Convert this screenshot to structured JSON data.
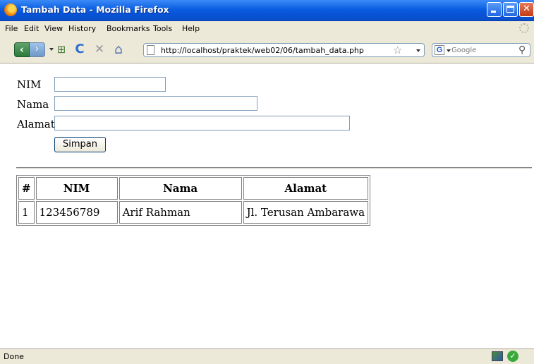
{
  "window": {
    "title": "Tambah Data - Mozilla Firefox"
  },
  "menu": [
    "File",
    "Edit",
    "View",
    "History",
    "Bookmarks",
    "Tools",
    "Help"
  ],
  "nav": {
    "url": "http://localhost/praktek/web02/06/tambah_data.php",
    "search_placeholder": "Google",
    "back_glyph": "‹",
    "forward_glyph": "›",
    "reload_glyph": "C",
    "stop_glyph": "✕",
    "home_glyph": "⌂",
    "bookmark_star_glyph": "☆",
    "search_engine_glyph": "G",
    "search_glyph": "⚲"
  },
  "form": {
    "nim_label": "NIM",
    "nama_label": "Nama",
    "alamat_label": "Alamat",
    "nim_value": "",
    "nama_value": "",
    "alamat_value": "",
    "submit_label": "Simpan"
  },
  "table": {
    "headers": [
      "#",
      "NIM",
      "Nama",
      "Alamat"
    ],
    "rows": [
      [
        "1",
        "123456789",
        "Arif Rahman",
        "Jl. Terusan Ambarawa"
      ]
    ]
  },
  "status": {
    "text": "Done",
    "check_glyph": "✓"
  },
  "colors": {
    "titlebar": "#0a5ee0",
    "chrome": "#ece9d8",
    "border": "#7f9db9"
  },
  "icons": [
    "firefox-icon",
    "back-icon",
    "forward-icon",
    "dropdown-icon",
    "page-icon",
    "reload-icon",
    "stop-icon",
    "home-icon",
    "star-icon",
    "google-icon",
    "search-icon",
    "throbber-icon",
    "addon-icon",
    "check-icon"
  ]
}
